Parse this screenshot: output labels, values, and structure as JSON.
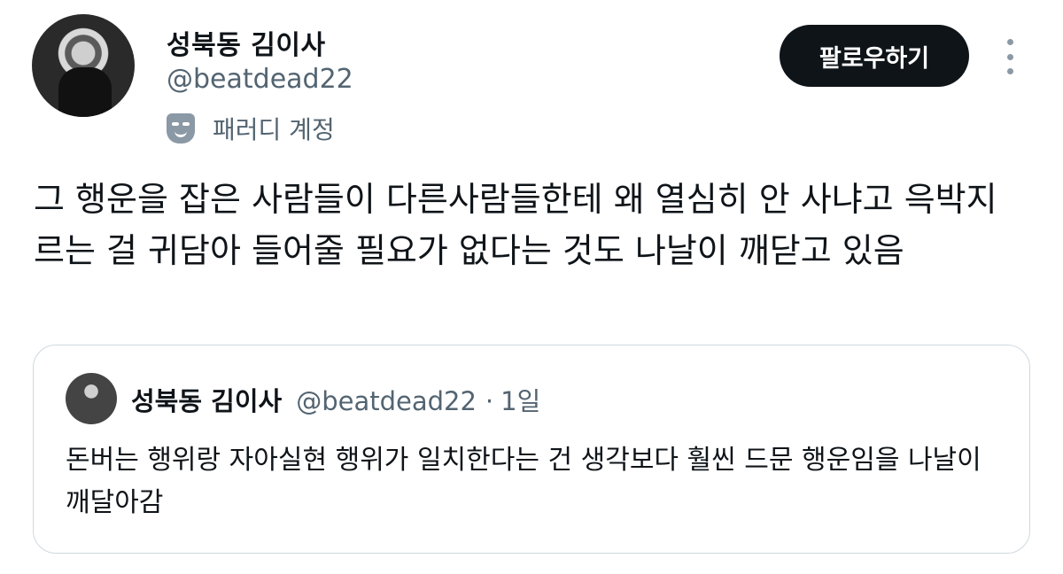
{
  "author": {
    "display_name": "성북동 김이사",
    "handle": "@beatdead22",
    "parody_label": "패러디 계정"
  },
  "actions": {
    "follow_label": "팔로우하기",
    "more_icon": "more-vertical-icon"
  },
  "tweet": {
    "text": "그 행운을 잡은 사람들이 다른사람들한테 왜 열심히 안 사냐고 윽박지르는 걸 귀담아 들어줄 필요가 없다는 것도 나날이 깨닫고 있음"
  },
  "quoted": {
    "display_name": "성북동 김이사",
    "handle": "@beatdead22",
    "separator": "·",
    "time": "1일",
    "text": "돈버는 행위랑 자아실현 행위가 일치한다는 건 생각보다 훨씬 드문 행운임을 나날이 깨달아감"
  },
  "colors": {
    "primary_text": "#0f1419",
    "secondary_text": "#536471",
    "follow_button_bg": "#0f1419",
    "border": "#cfd9de"
  }
}
